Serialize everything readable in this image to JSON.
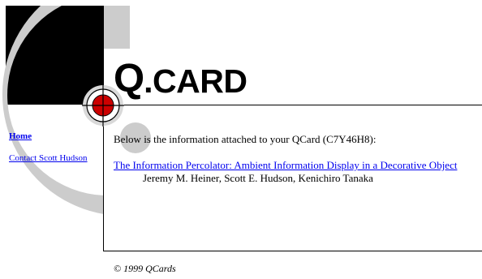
{
  "logo": {
    "q": "Q",
    "rest": ".CARD"
  },
  "nav": {
    "home": "Home",
    "contact": "Contact Scott Hudson"
  },
  "main": {
    "intro": "Below is the information attached to your QCard (C7Y46H8):",
    "paper_title": "The Information Percolator: Ambient Information Display in a Decorative Object",
    "authors": "Jeremy M. Heiner, Scott E. Hudson, Kenichiro Tanaka"
  },
  "footer": {
    "copyright": "© 1999 QCards"
  },
  "colors": {
    "link": "#0000ee",
    "accent_red": "#cc0000",
    "ring_gray": "#cccccc",
    "block_black": "#000000"
  }
}
